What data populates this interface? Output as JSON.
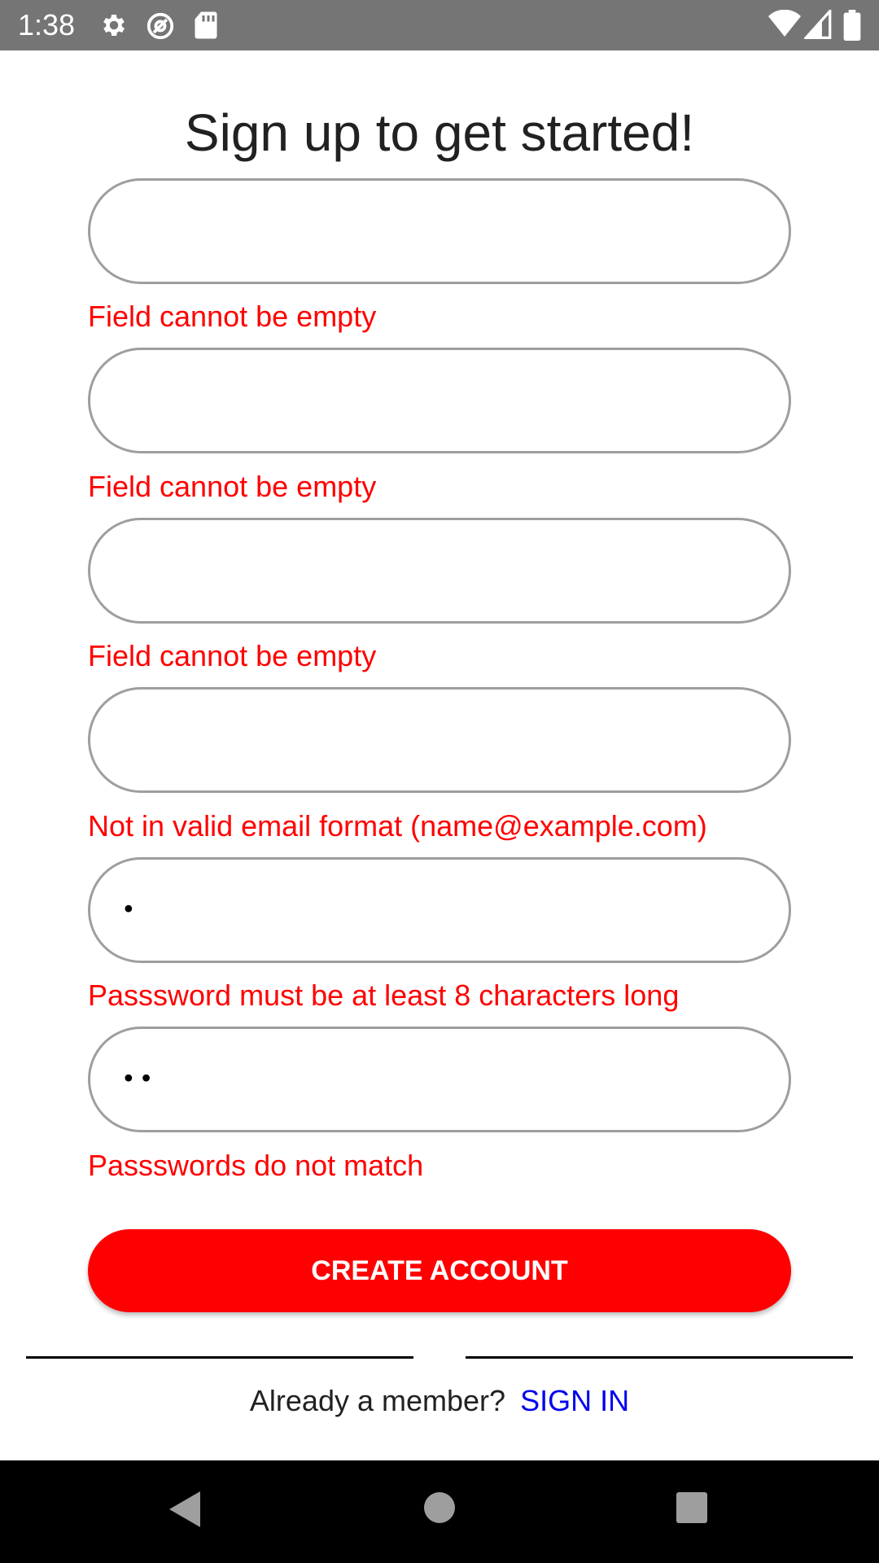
{
  "status_bar": {
    "time": "1:38",
    "icons_left": [
      "gear-icon",
      "at-sign-icon",
      "sd-card-icon"
    ],
    "icons_right": [
      "wifi-icon",
      "signal-icon",
      "battery-icon"
    ]
  },
  "form": {
    "title": "Sign up to get started!",
    "fields": [
      {
        "name": "field-1",
        "value": "",
        "error": "Field cannot be empty"
      },
      {
        "name": "field-2",
        "value": "",
        "error": "Field cannot be empty"
      },
      {
        "name": "field-3",
        "value": "",
        "error": "Field cannot be empty"
      },
      {
        "name": "email-field",
        "value": "",
        "error": "Not in valid email format (name@example.com)"
      },
      {
        "name": "password-field",
        "value": "•",
        "error": "Passsword must be at least 8 characters long"
      },
      {
        "name": "confirm-password-field",
        "value": "••",
        "error": "Passswords do not match"
      }
    ],
    "submit_label": "CREATE ACCOUNT"
  },
  "footer": {
    "prompt": "Already a member?",
    "link_label": "SIGN IN"
  },
  "nav_bar": {
    "buttons": [
      "back-icon",
      "home-icon",
      "recents-icon"
    ]
  },
  "colors": {
    "accent": "#ff0000",
    "link": "#0000ee",
    "status_bar": "#757575",
    "field_border": "#9e9e9e"
  }
}
